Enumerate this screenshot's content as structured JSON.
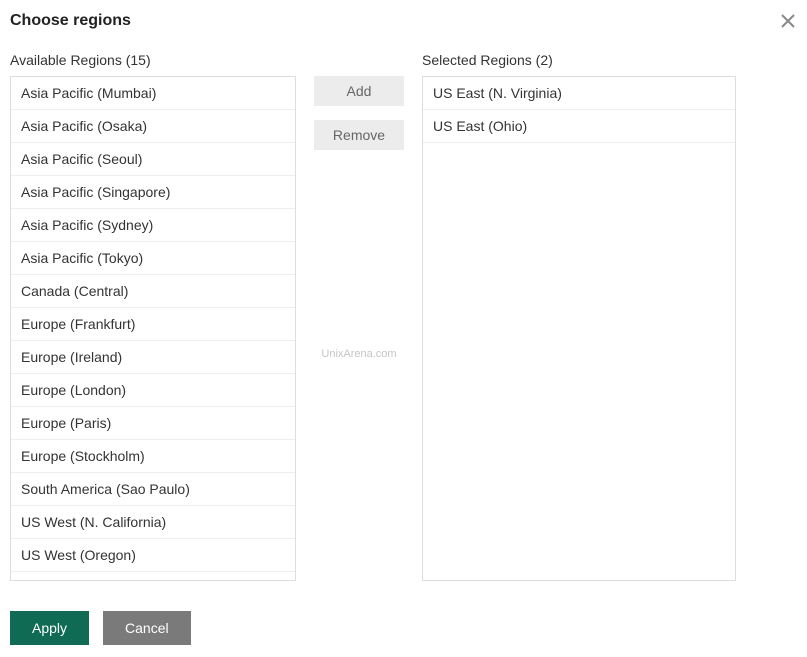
{
  "dialog": {
    "title": "Choose regions"
  },
  "available": {
    "label_prefix": "Available Regions",
    "count": 15,
    "items": [
      "Asia Pacific (Mumbai)",
      "Asia Pacific (Osaka)",
      "Asia Pacific (Seoul)",
      "Asia Pacific (Singapore)",
      "Asia Pacific (Sydney)",
      "Asia Pacific (Tokyo)",
      "Canada (Central)",
      "Europe (Frankfurt)",
      "Europe (Ireland)",
      "Europe (London)",
      "Europe (Paris)",
      "Europe (Stockholm)",
      "South America (Sao Paulo)",
      "US West (N. California)",
      "US West (Oregon)"
    ]
  },
  "selected": {
    "label_prefix": "Selected Regions",
    "count": 2,
    "items": [
      "US East (N. Virginia)",
      "US East (Ohio)"
    ]
  },
  "controls": {
    "add_label": "Add",
    "remove_label": "Remove"
  },
  "footer": {
    "apply_label": "Apply",
    "cancel_label": "Cancel"
  },
  "watermark": "UnixArena.com"
}
